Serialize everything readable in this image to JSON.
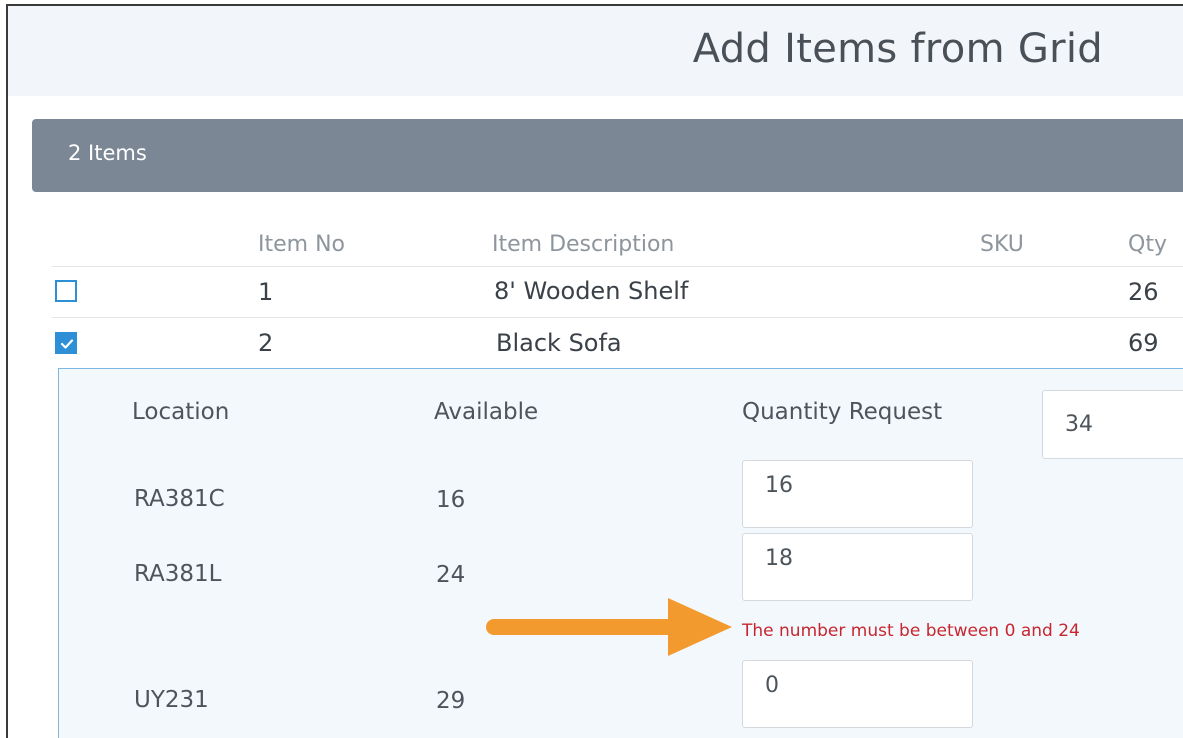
{
  "dialog": {
    "title": "Add Items from Grid"
  },
  "grid": {
    "count_label": "2 Items",
    "columns": [
      "Item No",
      "Item Description",
      "SKU",
      "Qty"
    ],
    "rows": [
      {
        "checked": false,
        "item_no": "1",
        "description": "8' Wooden Shelf",
        "sku": "",
        "qty": "26"
      },
      {
        "checked": true,
        "item_no": "2",
        "description": "Black Sofa",
        "sku": "",
        "qty": "69"
      }
    ]
  },
  "detail": {
    "headers": {
      "location": "Location",
      "available": "Available",
      "quantity_request": "Quantity Request"
    },
    "quantity_request_total": "34",
    "locations": [
      {
        "location": "RA381C",
        "available": "16",
        "request": "16"
      },
      {
        "location": "RA381L",
        "available": "24",
        "request": "18",
        "error": "The number must be between 0 and 24"
      },
      {
        "location": "UY231",
        "available": "29",
        "request": "0"
      }
    ]
  },
  "colors": {
    "accent": "#2d8fd5",
    "header_bar": "#7b8794",
    "error": "#c8262e",
    "annotation_arrow": "#f29a2e"
  }
}
